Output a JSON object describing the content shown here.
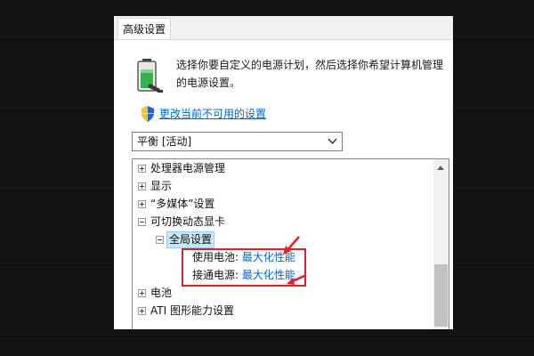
{
  "dialog": {
    "tab_label": "高级设置",
    "description": "选择你要自定义的电源计划，然后选择你希望计算机管理的电源设置。",
    "change_link": "更改当前不可用的设置",
    "plan_select": {
      "value": "平衡 [活动]"
    }
  },
  "tree": {
    "items": [
      {
        "label": "处理器电源管理",
        "expander": "plus"
      },
      {
        "label": "显示",
        "expander": "plus"
      },
      {
        "label": "“多媒体”设置",
        "expander": "plus"
      },
      {
        "label": "可切换动态显卡",
        "expander": "minus"
      },
      {
        "label": "全局设置",
        "expander": "minus",
        "selected": true
      },
      {
        "label": "使用电池:",
        "value": "最大化性能"
      },
      {
        "label": "接通电源:",
        "value": "最大化性能"
      },
      {
        "label": "电池",
        "expander": "plus"
      },
      {
        "label": "ATI 图形能力设置",
        "expander": "plus"
      }
    ]
  },
  "icons": {
    "battery": "battery-power-plan-icon",
    "shield": "uac-shield-icon",
    "dropdown": "chevron-down-icon",
    "scroll_up": "scroll-up-arrow-icon"
  },
  "colors": {
    "link": "#0066cc",
    "selection": "#cce4f7",
    "annotation": "#d8232a",
    "frame": "#121212"
  }
}
